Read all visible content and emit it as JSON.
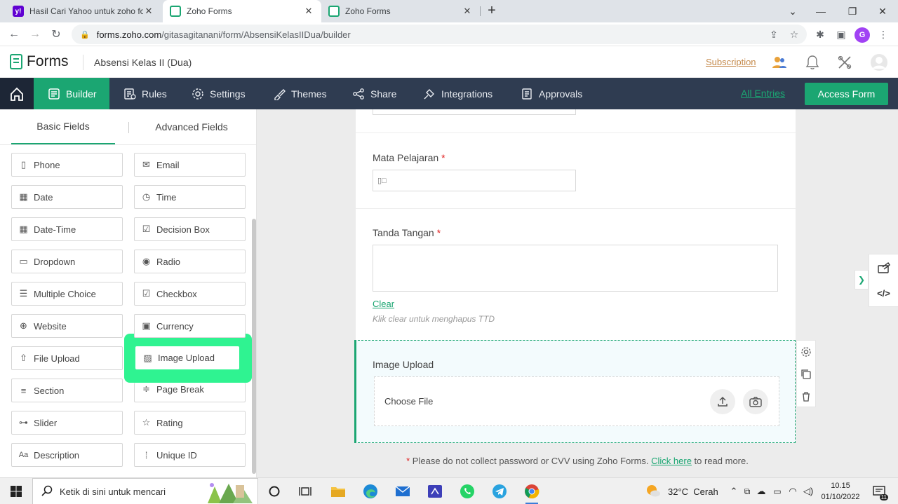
{
  "browser": {
    "tabs": [
      {
        "title": "Hasil Cari Yahoo untuk zoho form",
        "favicon": "yahoo-favicon"
      },
      {
        "title": "Zoho Forms",
        "favicon": "zoho-forms-favicon"
      },
      {
        "title": "Zoho Forms",
        "favicon": "zoho-forms-favicon"
      }
    ],
    "url_host": "forms.zoho.com",
    "url_path": "/gitasagitanani/form/AbsensiKelasIIDua/builder",
    "profile_initial": "G"
  },
  "header": {
    "app_name": "Forms",
    "form_name": "Absensi Kelas II (Dua)",
    "subscription_label": "Subscription"
  },
  "nav": {
    "items": [
      "Builder",
      "Rules",
      "Settings",
      "Themes",
      "Share",
      "Integrations",
      "Approvals"
    ],
    "all_entries_label": "All Entries",
    "access_form_label": "Access Form"
  },
  "left_panel": {
    "tabs": [
      "Basic Fields",
      "Advanced Fields"
    ],
    "fields": [
      "Phone",
      "Email",
      "Date",
      "Time",
      "Date-Time",
      "Decision Box",
      "Dropdown",
      "Radio",
      "Multiple Choice",
      "Checkbox",
      "Website",
      "Currency",
      "File Upload",
      "Image Upload",
      "Section",
      "Page Break",
      "Slider",
      "Rating",
      "Description",
      "Unique ID"
    ],
    "highlighted_field": "Image Upload"
  },
  "form": {
    "mata_pelajaran_label": "Mata Pelajaran",
    "mata_pelajaran_value": "",
    "tanda_tangan_label": "Tanda Tangan",
    "required_mark": "*",
    "clear_label": "Clear",
    "clear_hint": "Klik clear untuk menghapus TTD",
    "image_upload_label": "Image Upload",
    "choose_file_label": "Choose File"
  },
  "disclaimer": {
    "star": "*",
    "text": " Please do not collect password or CVV using Zoho Forms. ",
    "link": "Click here",
    "suffix": " to read more."
  },
  "taskbar": {
    "search_placeholder": "Ketik di sini untuk mencari",
    "weather": "32°C  Cerah",
    "time": "10.15",
    "date": "01/10/2022",
    "notification_count": "11"
  },
  "colors": {
    "brand_green": "#1ba672",
    "nav_bg": "#2f3c51",
    "highlight_green": "#2ff391",
    "subscription_link": "#c4894a"
  }
}
